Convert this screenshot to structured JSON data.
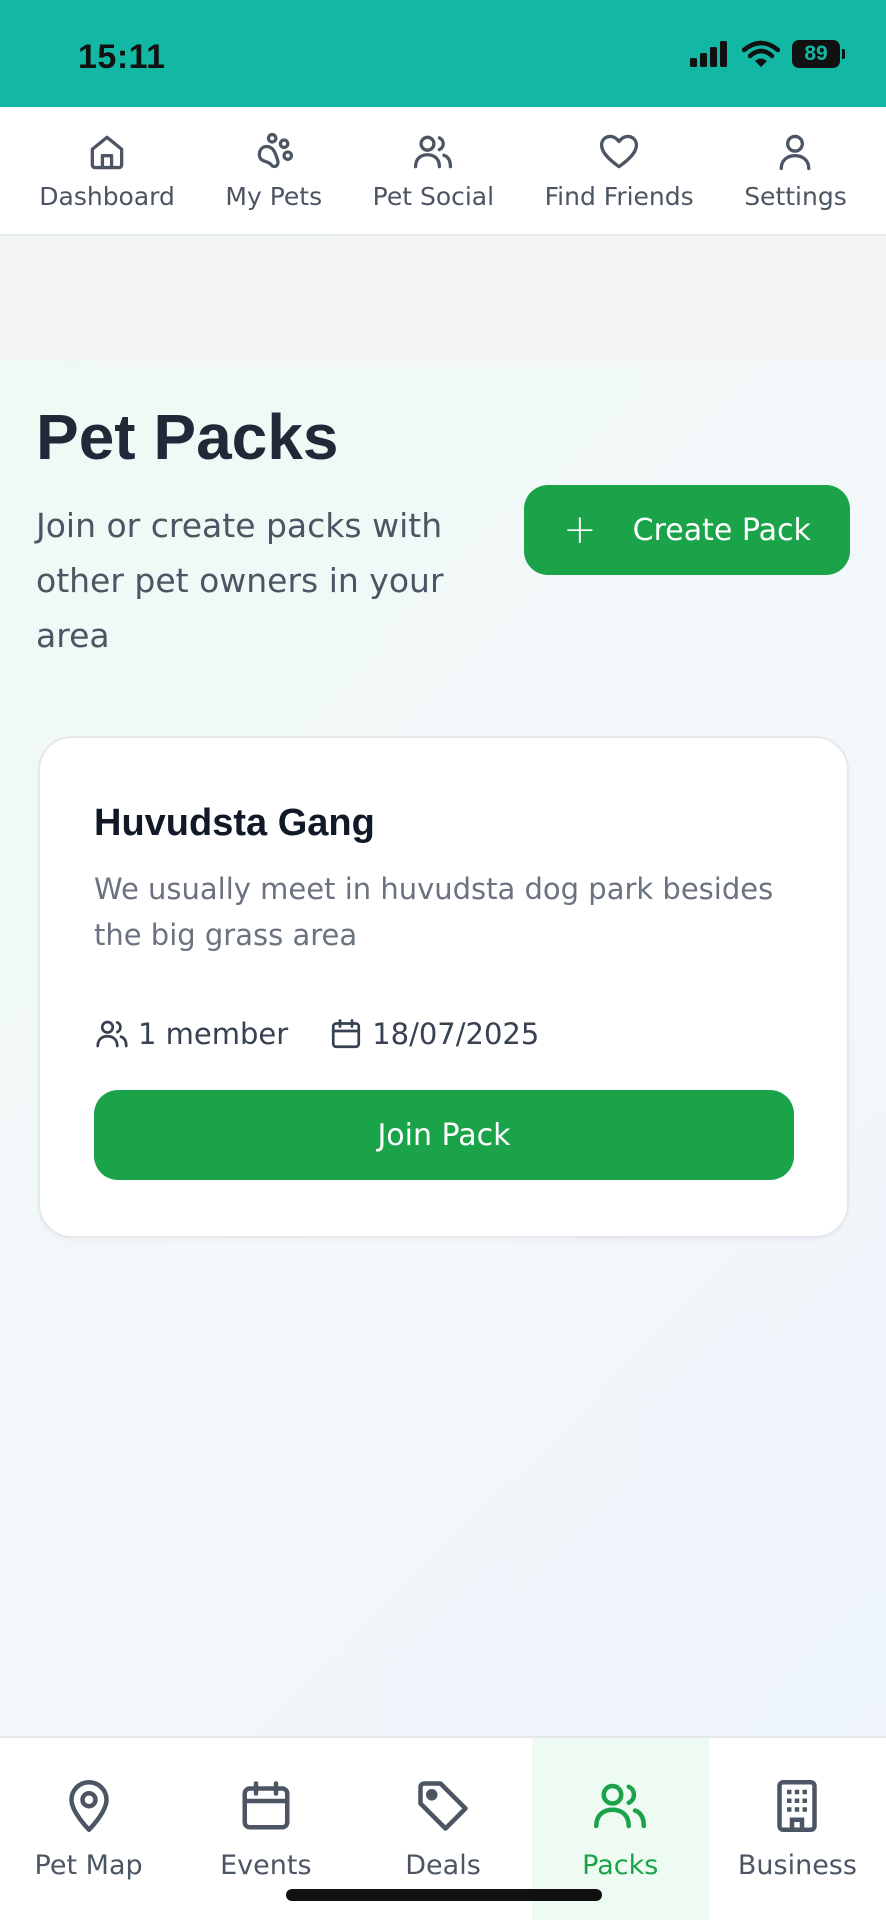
{
  "status_bar": {
    "time": "15:11",
    "battery": "89"
  },
  "top_nav": {
    "items": [
      {
        "label": "Dashboard",
        "icon": "home-icon"
      },
      {
        "label": "My Pets",
        "icon": "paw-icon"
      },
      {
        "label": "Pet Social",
        "icon": "users-icon"
      },
      {
        "label": "Find Friends",
        "icon": "heart-icon"
      },
      {
        "label": "Settings",
        "icon": "user-icon"
      }
    ]
  },
  "page": {
    "title": "Pet Packs",
    "subtitle": "Join or create packs with other pet owners in your area",
    "create_button": "Create Pack"
  },
  "packs": [
    {
      "name": "Huvudsta Gang",
      "description": "We usually meet in huvudsta dog park besides the big grass area",
      "members": "1 member",
      "date": "18/07/2025",
      "join_label": "Join Pack"
    }
  ],
  "bottom_nav": {
    "items": [
      {
        "label": "Pet Map",
        "icon": "map-pin-icon"
      },
      {
        "label": "Events",
        "icon": "calendar-icon"
      },
      {
        "label": "Deals",
        "icon": "tag-icon"
      },
      {
        "label": "Packs",
        "icon": "users-icon",
        "active": true
      },
      {
        "label": "Business",
        "icon": "building-icon"
      }
    ]
  },
  "colors": {
    "status_bar": "#13b8a5",
    "primary": "#1ba34a",
    "active_tab_bg": "#eefbf2"
  }
}
